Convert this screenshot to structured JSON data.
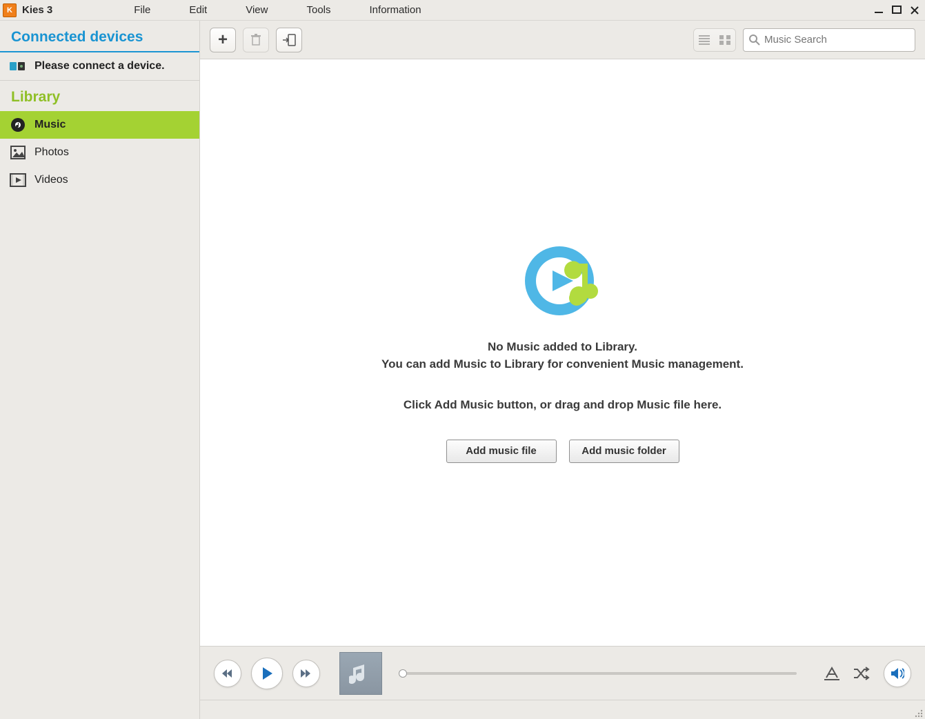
{
  "app": {
    "title": "Kies 3"
  },
  "menu": {
    "file": "File",
    "edit": "Edit",
    "view": "View",
    "tools": "Tools",
    "information": "Information"
  },
  "sidebar": {
    "connected_header": "Connected devices",
    "connect_prompt": "Please connect a device.",
    "library_header": "Library",
    "items": [
      {
        "label": "Music",
        "selected": true
      },
      {
        "label": "Photos",
        "selected": false
      },
      {
        "label": "Videos",
        "selected": false
      }
    ]
  },
  "toolbar": {
    "search_placeholder": "Music Search"
  },
  "empty": {
    "line1": "No Music added to Library.",
    "line2": "You can add Music to Library for convenient Music management.",
    "line3": "Click Add Music button, or drag and drop Music file here.",
    "add_file_btn": "Add music file",
    "add_folder_btn": "Add music folder"
  }
}
